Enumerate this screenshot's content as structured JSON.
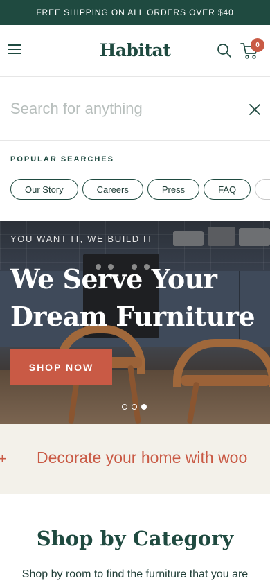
{
  "promo_bar": {
    "text": "FREE SHIPPING ON ALL ORDERS OVER $40"
  },
  "header": {
    "logo": "Habitat",
    "cart_count": "0",
    "icons": {
      "menu": "hamburger-menu-icon",
      "search": "search-icon",
      "cart": "shopping-cart-icon"
    }
  },
  "search": {
    "placeholder": "Search for anything",
    "value": "",
    "close_icon": "close-icon"
  },
  "popular_searches": {
    "title": "POPULAR SEARCHES",
    "chips": [
      "Our Story",
      "Careers",
      "Press",
      "FAQ"
    ]
  },
  "hero": {
    "kicker": "YOU WANT IT, WE BUILD IT",
    "title": "We Serve Your Dream Furniture",
    "cta": "SHOP NOW",
    "slides": 3,
    "active_slide": 3
  },
  "marquee": {
    "separator": "+",
    "text": "Decorate your home with woo"
  },
  "shop_by_category": {
    "title": "Shop by Category",
    "subtitle": "Shop by room to find the furniture that you are"
  },
  "colors": {
    "brand_green": "#1f4a40",
    "accent_terracotta": "#c95a45",
    "marquee_bg": "#f3f1ea"
  }
}
